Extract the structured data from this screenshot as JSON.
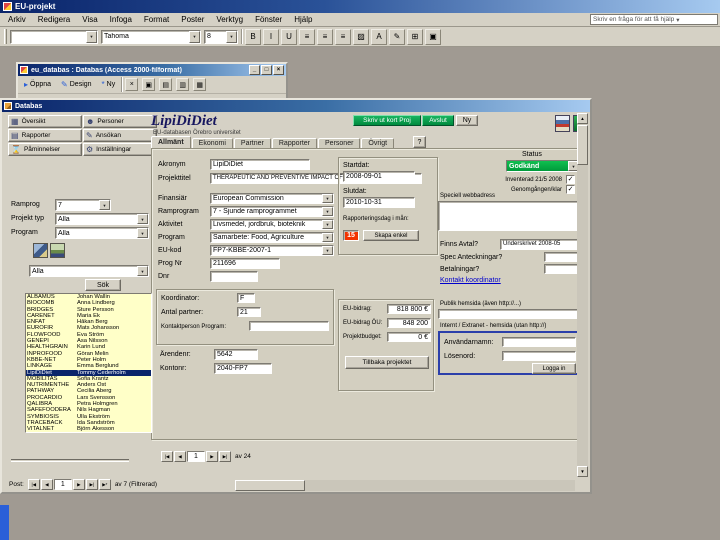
{
  "app": {
    "title": "EU-projekt",
    "help_box": "Skriv en fråga för att få hjälp",
    "menus": [
      {
        "name": "menu-arkiv",
        "label": "Arkiv"
      },
      {
        "name": "menu-redigera",
        "label": "Redigera"
      },
      {
        "name": "menu-visa",
        "label": "Visa"
      },
      {
        "name": "menu-infoga",
        "label": "Infoga"
      },
      {
        "name": "menu-format",
        "label": "Format"
      },
      {
        "name": "menu-poster",
        "label": "Poster"
      },
      {
        "name": "menu-verktyg",
        "label": "Verktyg"
      },
      {
        "name": "menu-fonster",
        "label": "Fönster"
      },
      {
        "name": "menu-hjalp",
        "label": "Hjälp"
      }
    ],
    "toolbar": {
      "object_value": "",
      "font_value": "Tahoma",
      "size_value": "8",
      "buttons": [
        {
          "name": "bold-button",
          "glyph": "B"
        },
        {
          "name": "italic-button",
          "glyph": "I"
        },
        {
          "name": "underline-button",
          "glyph": "U"
        },
        {
          "name": "align-left-button",
          "glyph": "≡"
        },
        {
          "name": "align-center-button",
          "glyph": "≡"
        },
        {
          "name": "align-right-button",
          "glyph": "≡"
        },
        {
          "name": "fill-color-button",
          "glyph": "▨"
        },
        {
          "name": "font-color-button",
          "glyph": "A"
        },
        {
          "name": "line-color-button",
          "glyph": "✎"
        },
        {
          "name": "borders-button",
          "glyph": "⊞"
        },
        {
          "name": "special-effect-button",
          "glyph": "▣"
        }
      ]
    }
  },
  "db_window": {
    "title": "eu_databas : Databas (Access 2000-filformat)",
    "controls": [
      {
        "name": "minimize-button",
        "glyph": "_"
      },
      {
        "name": "maximize-button",
        "glyph": "□"
      },
      {
        "name": "close-button",
        "glyph": "×"
      }
    ],
    "buttons": [
      {
        "name": "open-button",
        "glyph": "▸",
        "label": "Öppna"
      },
      {
        "name": "design-button",
        "glyph": "✎",
        "label": "Design"
      },
      {
        "name": "new-button",
        "glyph": "*",
        "label": "Ny"
      }
    ],
    "icon_buttons": [
      {
        "name": "delete-button",
        "glyph": "×"
      },
      {
        "name": "large-icons-button",
        "glyph": "▣"
      },
      {
        "name": "small-icons-button",
        "glyph": "▤"
      },
      {
        "name": "list-view-button",
        "glyph": "▥"
      },
      {
        "name": "details-view-button",
        "glyph": "▦"
      }
    ]
  },
  "form": {
    "title": "Databas",
    "nav_buttons": [
      {
        "name": "nav-oversikt-button",
        "icon": "overview-icon",
        "glyph": "▦",
        "label": "Översikt"
      },
      {
        "name": "nav-personer-button",
        "icon": "people-icon",
        "glyph": "☻",
        "label": "Personer"
      },
      {
        "name": "nav-rapporter-button",
        "icon": "reports-icon",
        "glyph": "▤",
        "label": "Rapporter"
      },
      {
        "name": "nav-ansokan-button",
        "icon": "application-icon",
        "glyph": "✎",
        "label": "Ansökan"
      },
      {
        "name": "nav-paminnelser-button",
        "icon": "reminders-icon",
        "glyph": "⌛",
        "label": "Påminnelser"
      },
      {
        "name": "nav-installningar-button",
        "icon": "settings-icon",
        "glyph": "⚙",
        "label": "Inställningar"
      }
    ],
    "header": {
      "title": "LipiDiDiet",
      "subtitle": "EU-databasen Örebro universitet"
    },
    "actions": {
      "print_card": "Skriv ut kort Proj",
      "close_project": "Avslut",
      "new_button": "Ny"
    },
    "tabs": [
      {
        "name": "tab-allmant",
        "label": "Allmänt",
        "active": true
      },
      {
        "name": "tab-ekonomi",
        "label": "Ekonomi"
      },
      {
        "name": "tab-partner",
        "label": "Partner"
      },
      {
        "name": "tab-rapporter",
        "label": "Rapporter"
      },
      {
        "name": "tab-personer",
        "label": "Personer"
      },
      {
        "name": "tab-ovrigt",
        "label": "Övrigt"
      }
    ],
    "help_button": "?"
  },
  "filter": {
    "ramprog": {
      "label": "Ramprog",
      "value": "7"
    },
    "projekttyp": {
      "label": "Projekt typ",
      "value": "Alla"
    },
    "program": {
      "label": "Program",
      "value": "Alla"
    },
    "urval": {
      "value": "Alla"
    },
    "search_button": "Sök",
    "projects": [
      {
        "acronym": "ALBAMUS",
        "contact": "Johan Wallin"
      },
      {
        "acronym": "BIOCOMB",
        "contact": "Anna Lindberg"
      },
      {
        "acronym": "BRIDGES",
        "contact": "Sture Persson"
      },
      {
        "acronym": "CARENET",
        "contact": "Maria Ek"
      },
      {
        "acronym": "ENFAT",
        "contact": "Håkan Berg"
      },
      {
        "acronym": "EUROFIR",
        "contact": "Mats Johansson"
      },
      {
        "acronym": "FLOWFOOD",
        "contact": "Eva Ström"
      },
      {
        "acronym": "GENEPI",
        "contact": "Åsa Nilsson"
      },
      {
        "acronym": "HEALTHGRAIN",
        "contact": "Karin Lund"
      },
      {
        "acronym": "INPROFOOD",
        "contact": "Göran Melin"
      },
      {
        "acronym": "KBBE-NET",
        "contact": "Peter Holm"
      },
      {
        "acronym": "LINKAGE",
        "contact": "Emma Berglund"
      },
      {
        "acronym": "LipiDiDiet",
        "contact": "Tommy Cederholm",
        "selected": true
      },
      {
        "acronym": "MOBILITAS",
        "contact": "Sofia Krantz"
      },
      {
        "acronym": "NUTRIMENTHE",
        "contact": "Anders Öst"
      },
      {
        "acronym": "PATHWAY",
        "contact": "Cecilia Åberg"
      },
      {
        "acronym": "PROCARDIO",
        "contact": "Lars Svensson"
      },
      {
        "acronym": "QALIBRA",
        "contact": "Petra Holmgren"
      },
      {
        "acronym": "SAFEFOODERA",
        "contact": "Nils Hagman"
      },
      {
        "acronym": "SYMBIOSIS",
        "contact": "Ulla Ekström"
      },
      {
        "acronym": "TRACEBACK",
        "contact": "Ida Sandström"
      },
      {
        "acronym": "VITALNET",
        "contact": "Björn Åkesson"
      }
    ]
  },
  "details": {
    "akronym": {
      "label": "Akronym",
      "value": "LipiDiDiet"
    },
    "projekttitel": {
      "label": "Projekttitel",
      "value": "THERAPEUTIC AND PREVENTIVE IMPACT OF NUTRITIONAL LIPIDS"
    },
    "finansiar": {
      "label": "Finansiär",
      "value": "European Commission"
    },
    "ramprogram": {
      "label": "Ramprogram",
      "value": "7 - Sjunde ramprogrammet"
    },
    "aktivitet": {
      "label": "Aktivitet",
      "value": "Livsmedel, jordbruk, bioteknik"
    },
    "program": {
      "label": "Program",
      "value": "Samarbete: Food, Agriculture"
    },
    "eukod": {
      "label": "EU-kod",
      "value": "FP7-KBBE-2007-1"
    },
    "prognr": {
      "label": "Prog Nr",
      "value": "211696"
    },
    "dnr": {
      "label": "Dnr",
      "value": ""
    },
    "startdat": {
      "label": "Startdat:",
      "value": "2008-09-01"
    },
    "slutdat": {
      "label": "Slutdat:",
      "value": "2010-10-31"
    },
    "rapportdag": {
      "label": "Rapporteringsdag i mån:",
      "value": "15",
      "button": "Skapa enkel"
    },
    "status": {
      "label": "Status",
      "value": "Godkänd"
    },
    "inventerad": {
      "label": "Inventerad 21/5 2008",
      "checked": "✓"
    },
    "genomgangen": {
      "label": "Genomgången/klar",
      "checked": "✓"
    },
    "webbadress": {
      "label": "Speciell webbadress",
      "value": ""
    },
    "avtal": {
      "label": "Finns Avtal?",
      "value": "Underskrivet 2008-05"
    },
    "spec_ant": {
      "label": "Spec Anteckningar?",
      "value": ""
    },
    "betalningar": {
      "label": "Betalningar?",
      "value": ""
    },
    "kontakt_link": "Kontakt koordinator",
    "koordinator": {
      "label": "Koordinator:",
      "value": "F"
    },
    "antal_partner": {
      "label": "Antal partner:",
      "value": "21"
    },
    "kontaktperson": {
      "label": "Kontaktperson Program:",
      "value": ""
    },
    "arendenr": {
      "label": "Ärendenr:",
      "value": "5642"
    },
    "kontonr": {
      "label": "Kontonr:",
      "value": "2040-FP7"
    },
    "eu_bidrag": {
      "label": "EU-bidrag:",
      "value": "818 800 €"
    },
    "eu_bidrag_ou": {
      "label": "EU-bidrag ÖU:",
      "value": "848 200"
    },
    "projektbudget": {
      "label": "Projektbudget:",
      "value": "0 €"
    },
    "tillbaka_button": "Tillbaka projektet",
    "publik_hemsida": {
      "label": "Publik hemsida (även http://...)",
      "value": ""
    },
    "intern_hemsida_label": "Internt / Extranet - hemsida (utan http://)",
    "anvandarnamn": {
      "label": "Användarnamn:",
      "value": ""
    },
    "losenord": {
      "label": "Lösenord:",
      "value": ""
    },
    "login_button": "Logga in"
  },
  "navigators": {
    "mini": {
      "value": "1",
      "count": "av 24",
      "buttons_left": [
        {
          "glyph": "|◀"
        },
        {
          "glyph": "◀"
        }
      ],
      "buttons_right": [
        {
          "glyph": "▶"
        },
        {
          "glyph": "▶|"
        }
      ]
    },
    "main": {
      "label": "Post:",
      "value": "1",
      "count": "av 7 (Filtrerad)",
      "buttons_left": [
        {
          "glyph": "|◀"
        },
        {
          "glyph": "◀"
        }
      ],
      "buttons_right": [
        {
          "glyph": "▶"
        },
        {
          "glyph": "▶|"
        },
        {
          "glyph": "▶*"
        }
      ]
    }
  }
}
